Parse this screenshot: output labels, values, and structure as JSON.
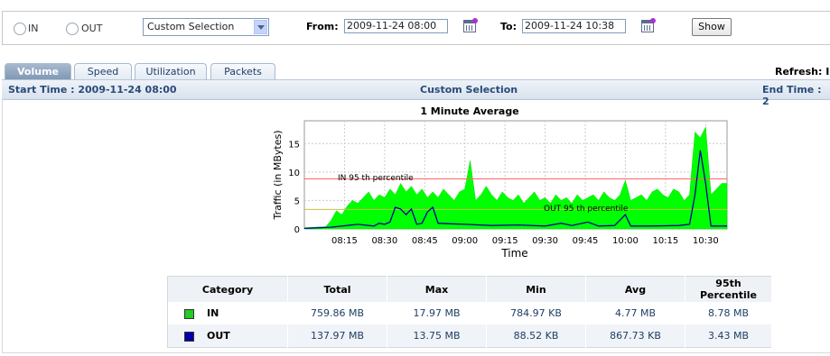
{
  "controls": {
    "radio_in": "IN",
    "radio_out": "OUT",
    "selection": "Custom Selection",
    "from_label": "From:",
    "from_value": "2009-11-24 08:00",
    "to_label": "To:",
    "to_value": "2009-11-24 10:38",
    "show_label": "Show"
  },
  "tabs": [
    "Volume",
    "Speed",
    "Utilization",
    "Packets"
  ],
  "active_tab": "Volume",
  "refresh_label": "Refresh: I",
  "timebar": {
    "start": "Start Time : 2009-11-24 08:00",
    "center": "Custom Selection",
    "end": "End Time : 2"
  },
  "chart_data": {
    "type": "area",
    "title": "1 Minute Average",
    "xlabel": "Time",
    "ylabel": "Traffic (in MBytes)",
    "x_range": [
      "08:00",
      "10:38"
    ],
    "ylim": [
      0,
      19
    ],
    "yticks": [
      0,
      5,
      10,
      15
    ],
    "xticks": [
      "08:15",
      "08:30",
      "08:45",
      "09:00",
      "09:15",
      "09:30",
      "09:45",
      "10:00",
      "10:15",
      "10:30"
    ],
    "grid": true,
    "series": [
      {
        "name": "IN",
        "color": "#00ff00",
        "points": [
          [
            0,
            0.2
          ],
          [
            4,
            0.3
          ],
          [
            8,
            0.4
          ],
          [
            10,
            1.5
          ],
          [
            12,
            3.2
          ],
          [
            14,
            2.5
          ],
          [
            16,
            4.0
          ],
          [
            18,
            5.0
          ],
          [
            20,
            4.5
          ],
          [
            22,
            5.5
          ],
          [
            24,
            6.5
          ],
          [
            26,
            5.0
          ],
          [
            28,
            6.0
          ],
          [
            30,
            5.5
          ],
          [
            32,
            7.0
          ],
          [
            34,
            6.0
          ],
          [
            36,
            8.0
          ],
          [
            38,
            6.5
          ],
          [
            40,
            7.5
          ],
          [
            42,
            6.0
          ],
          [
            44,
            7.0
          ],
          [
            46,
            5.5
          ],
          [
            48,
            6.5
          ],
          [
            50,
            5.5
          ],
          [
            52,
            7.0
          ],
          [
            54,
            6.0
          ],
          [
            56,
            5.0
          ],
          [
            58,
            6.5
          ],
          [
            60,
            7.0
          ],
          [
            62,
            12.0
          ],
          [
            64,
            5.0
          ],
          [
            66,
            6.0
          ],
          [
            68,
            7.5
          ],
          [
            70,
            6.0
          ],
          [
            72,
            5.0
          ],
          [
            74,
            6.5
          ],
          [
            76,
            5.5
          ],
          [
            78,
            5.0
          ],
          [
            80,
            6.0
          ],
          [
            82,
            4.5
          ],
          [
            84,
            5.5
          ],
          [
            86,
            6.5
          ],
          [
            88,
            5.0
          ],
          [
            90,
            5.5
          ],
          [
            92,
            4.5
          ],
          [
            94,
            6.0
          ],
          [
            96,
            5.0
          ],
          [
            98,
            5.5
          ],
          [
            100,
            4.5
          ],
          [
            102,
            6.0
          ],
          [
            104,
            5.0
          ],
          [
            106,
            5.5
          ],
          [
            108,
            6.0
          ],
          [
            110,
            5.0
          ],
          [
            112,
            6.5
          ],
          [
            114,
            5.5
          ],
          [
            116,
            5.0
          ],
          [
            118,
            6.0
          ],
          [
            120,
            8.5
          ],
          [
            122,
            5.0
          ],
          [
            124,
            5.5
          ],
          [
            126,
            6.0
          ],
          [
            128,
            5.0
          ],
          [
            130,
            6.5
          ],
          [
            132,
            7.0
          ],
          [
            134,
            6.0
          ],
          [
            136,
            5.5
          ],
          [
            138,
            7.0
          ],
          [
            140,
            6.5
          ],
          [
            142,
            5.0
          ],
          [
            144,
            6.0
          ],
          [
            146,
            17.0
          ],
          [
            148,
            16.0
          ],
          [
            150,
            17.9
          ],
          [
            152,
            6.0
          ],
          [
            154,
            7.0
          ],
          [
            156,
            8.0
          ],
          [
            158,
            8.0
          ]
        ]
      },
      {
        "name": "OUT",
        "color": "#0000a0",
        "points": [
          [
            0,
            0.1
          ],
          [
            10,
            0.3
          ],
          [
            20,
            0.8
          ],
          [
            26,
            0.5
          ],
          [
            28,
            1.0
          ],
          [
            30,
            0.8
          ],
          [
            32,
            1.2
          ],
          [
            34,
            3.8
          ],
          [
            36,
            3.5
          ],
          [
            38,
            2.5
          ],
          [
            40,
            3.5
          ],
          [
            42,
            0.8
          ],
          [
            44,
            1.0
          ],
          [
            46,
            3.0
          ],
          [
            48,
            3.8
          ],
          [
            50,
            1.0
          ],
          [
            60,
            0.8
          ],
          [
            70,
            0.6
          ],
          [
            80,
            0.7
          ],
          [
            90,
            0.5
          ],
          [
            96,
            1.0
          ],
          [
            100,
            0.6
          ],
          [
            106,
            1.2
          ],
          [
            110,
            0.5
          ],
          [
            116,
            0.6
          ],
          [
            120,
            2.5
          ],
          [
            122,
            0.5
          ],
          [
            130,
            0.5
          ],
          [
            140,
            0.6
          ],
          [
            144,
            0.8
          ],
          [
            146,
            6.0
          ],
          [
            148,
            13.8
          ],
          [
            150,
            8.0
          ],
          [
            152,
            0.5
          ],
          [
            158,
            0.5
          ]
        ]
      }
    ],
    "reference_lines": [
      {
        "name": "IN 95 th percentile",
        "value": 8.78,
        "color": "#ff7070"
      },
      {
        "name": "OUT 95 th percentile",
        "value": 3.43,
        "color": "#c8c040"
      }
    ]
  },
  "stats": {
    "headers": [
      "Category",
      "Total",
      "Max",
      "Min",
      "Avg",
      "95th Percentile"
    ],
    "rows": [
      {
        "name": "IN",
        "color": "#22cc22",
        "values": [
          "759.86 MB",
          "17.97 MB",
          "784.97 KB",
          "4.77 MB",
          "8.78 MB"
        ]
      },
      {
        "name": "OUT",
        "color": "#0000aa",
        "values": [
          "137.97 MB",
          "13.75 MB",
          "88.52 KB",
          "867.73 KB",
          "3.43 MB"
        ]
      }
    ]
  }
}
